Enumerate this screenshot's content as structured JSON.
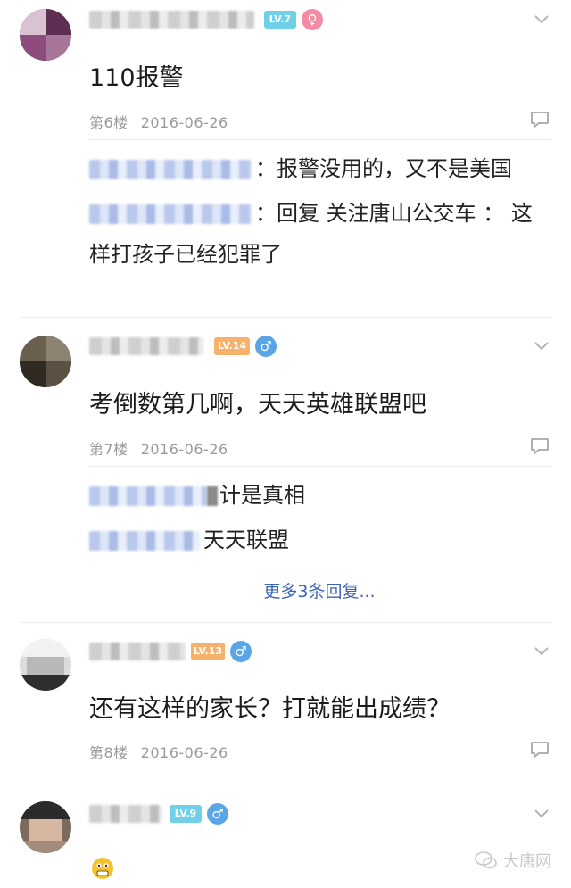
{
  "posts": [
    {
      "level_badge": "LV.7",
      "level_color": "#6fd0e8",
      "gender_icon": "female-icon",
      "gender_symbol": "♀",
      "gender_color": "#f58aa3",
      "content": "110报警",
      "floor": "第6楼",
      "date": "2016-06-26",
      "replies": [
        {
          "text": "：报警没用的，又不是美国"
        },
        {
          "text": "：回复 关注唐山公交车 ： 这样打孩子已经犯罪了"
        }
      ]
    },
    {
      "level_badge": "LV.14",
      "level_color": "#f6b26b",
      "gender_icon": "male-icon",
      "gender_symbol": "♂",
      "gender_color": "#5aa5e6",
      "content": "考倒数第几啊，天天英雄联盟吧",
      "floor": "第7楼",
      "date": "2016-06-26",
      "replies": [
        {
          "text": "计是真相"
        },
        {
          "text": "天天联盟"
        }
      ],
      "more_replies": "更多3条回复..."
    },
    {
      "level_badge": "LV.13",
      "level_color": "#f6b26b",
      "gender_icon": "male-icon",
      "gender_symbol": "♂",
      "gender_color": "#5aa5e6",
      "content": "还有这样的家长？打就能出成绩？",
      "floor": "第8楼",
      "date": "2016-06-26"
    },
    {
      "level_badge": "LV.9",
      "level_color": "#6fd0e8",
      "gender_icon": "male-icon",
      "gender_symbol": "♂",
      "gender_color": "#5aa5e6"
    }
  ],
  "watermark": "大唐网"
}
